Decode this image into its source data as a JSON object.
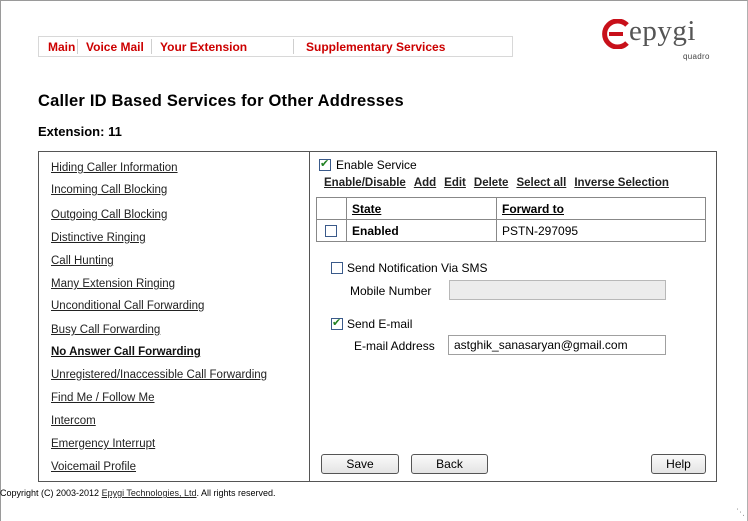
{
  "nav": {
    "items": [
      {
        "label": "Main"
      },
      {
        "label": "Voice Mail"
      },
      {
        "label": "Your Extension"
      },
      {
        "label": "Supplementary Services"
      }
    ],
    "accent_color": "#cc0000"
  },
  "logo": {
    "word": "epygi",
    "sub": "quadro",
    "icon": "epygi-logo-icon"
  },
  "page": {
    "title": "Caller ID Based Services for Other Addresses",
    "extension_label": "Extension: 11"
  },
  "sidebar": {
    "items": [
      {
        "label": "Hiding Caller Information"
      },
      {
        "label": "Incoming Call Blocking"
      },
      {
        "label": "Outgoing Call Blocking"
      },
      {
        "label": "Distinctive Ringing"
      },
      {
        "label": "Call Hunting"
      },
      {
        "label": "Many Extension Ringing"
      },
      {
        "label": "Unconditional Call Forwarding"
      },
      {
        "label": "Busy Call Forwarding"
      },
      {
        "label": "No Answer Call Forwarding"
      },
      {
        "label": "Unregistered/Inaccessible Call Forwarding"
      },
      {
        "label": "Find Me / Follow Me"
      },
      {
        "label": "Intercom"
      },
      {
        "label": "Emergency Interrupt"
      },
      {
        "label": "Voicemail Profile"
      }
    ],
    "active": "No Answer Call Forwarding"
  },
  "panel": {
    "enable_service": {
      "label": "Enable Service",
      "checked": true
    },
    "toolbar": {
      "enable_disable": "Enable/Disable",
      "add": "Add",
      "edit": "Edit",
      "delete": "Delete",
      "select_all": "Select all",
      "inverse_selection": "Inverse Selection"
    },
    "table": {
      "headers": [
        "State",
        "Forward to"
      ],
      "rows": [
        {
          "checked": false,
          "state": "Enabled",
          "forward_to": "PSTN-297095"
        }
      ]
    },
    "sms": {
      "label": "Send Notification Via SMS",
      "checked": false,
      "field_label": "Mobile Number",
      "value": ""
    },
    "email": {
      "label": "Send E-mail",
      "checked": true,
      "field_label": "E-mail Address",
      "value": "astghik_sanasaryan@gmail.com"
    },
    "buttons": {
      "save": "Save",
      "back": "Back",
      "help": "Help"
    }
  },
  "footer": {
    "prefix": "Copyright (C) 2003-2012 ",
    "link": "Epygi Technologies, Ltd",
    "suffix": ". All rights reserved."
  }
}
